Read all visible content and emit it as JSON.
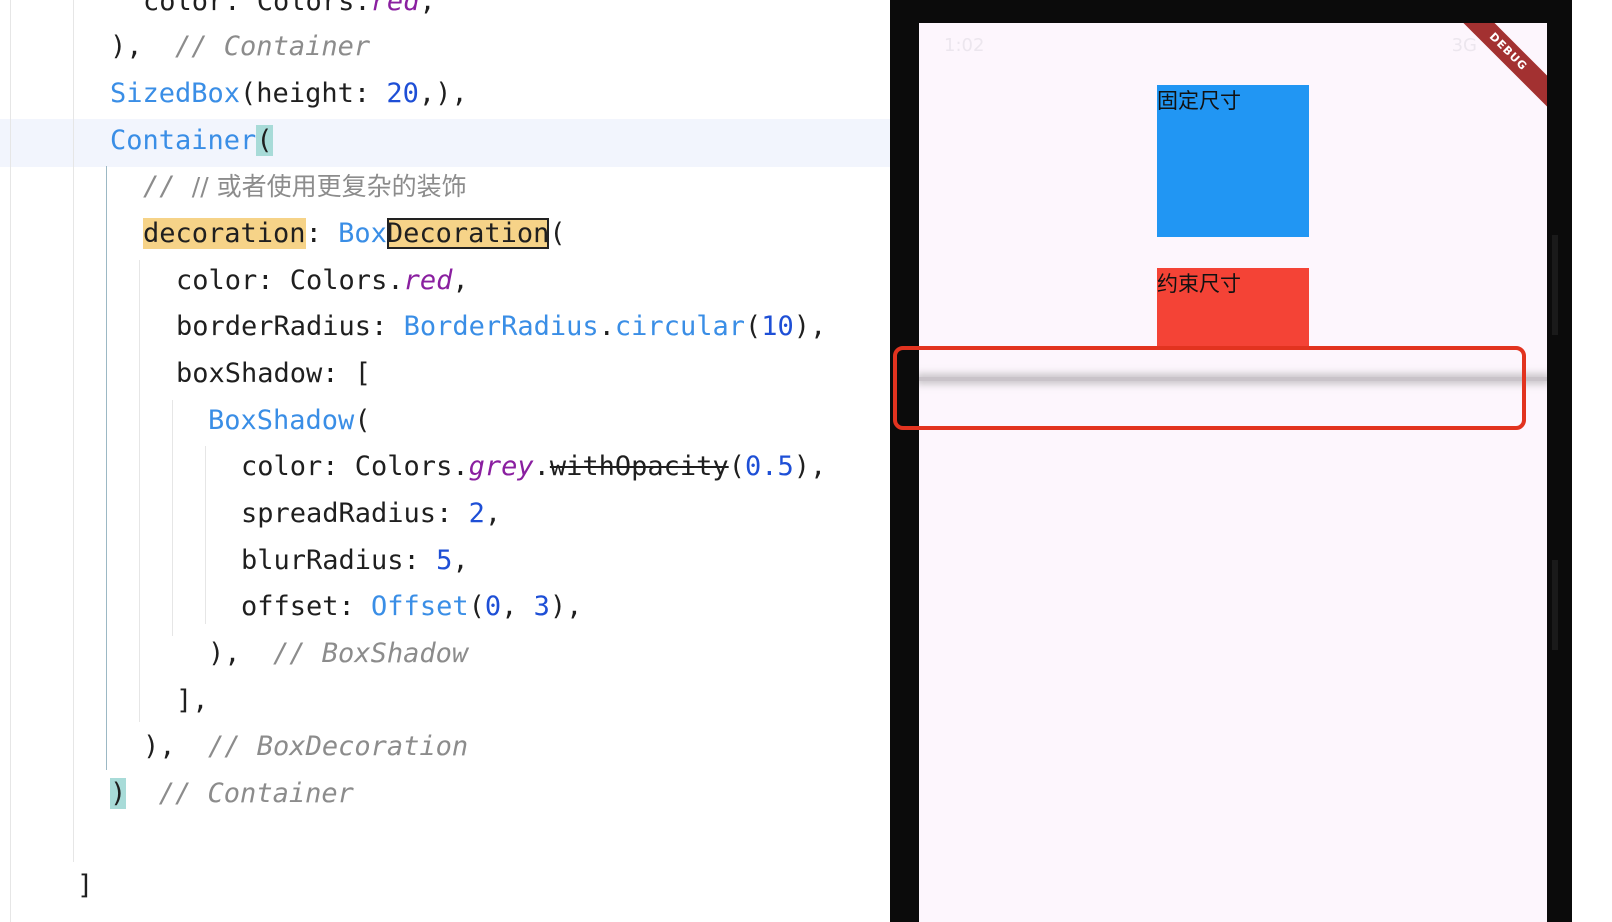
{
  "editor": {
    "lines": [
      {
        "seg": [
          "color: Colors.",
          "red",
          ","
        ]
      },
      {
        "code": "),  ",
        "comment": "// Container"
      },
      {
        "cls": "SizedBox",
        "rest": "(height: ",
        "num": "20",
        "end": ",),"
      },
      {
        "cls": "Container",
        "bracket": "("
      },
      {
        "comment": "// 或者使用更复杂的装饰"
      },
      {
        "hl": "decoration",
        "sep": ": ",
        "cls": "Box",
        "hlbox": "Decoration",
        "end": "("
      },
      {
        "code": "color: Colors.",
        "prop": "red",
        "end": ","
      },
      {
        "code": "borderRadius: ",
        "cls1": "BorderRadius",
        "dot": ".",
        "cls2": "circular",
        "open": "(",
        "num": "10",
        "end": "),"
      },
      {
        "code": "boxShadow: ["
      },
      {
        "cls": "BoxShadow",
        "end": "("
      },
      {
        "code": "color: Colors.",
        "prop": "grey",
        "dot": ".",
        "strike": "withOpacity",
        "open": "(",
        "num": "0.5",
        "end": "),"
      },
      {
        "code": "spreadRadius: ",
        "num": "2",
        "end": ","
      },
      {
        "code": "blurRadius: ",
        "num": "5",
        "end": ","
      },
      {
        "code": "offset: ",
        "cls": "Offset",
        "open": "(",
        "num1": "0",
        "sep": ", ",
        "num2": "3",
        "end": "),"
      },
      {
        "code": "),  ",
        "comment": "// BoxShadow"
      },
      {
        "code": "],"
      },
      {
        "code": "),  ",
        "comment": "// BoxDecoration"
      },
      {
        "bracket": ")",
        "comment": "// Container"
      },
      {
        "code": "]"
      }
    ]
  },
  "phone": {
    "status_time": "1:02",
    "status_network": "3G",
    "debug_banner": "DEBUG",
    "box_fixed_label": "固定尺寸",
    "box_constrained_label": "约束尺寸",
    "colors": {
      "blue": "#2196f3",
      "red": "#f44336",
      "highlight": "#e2331f"
    }
  }
}
